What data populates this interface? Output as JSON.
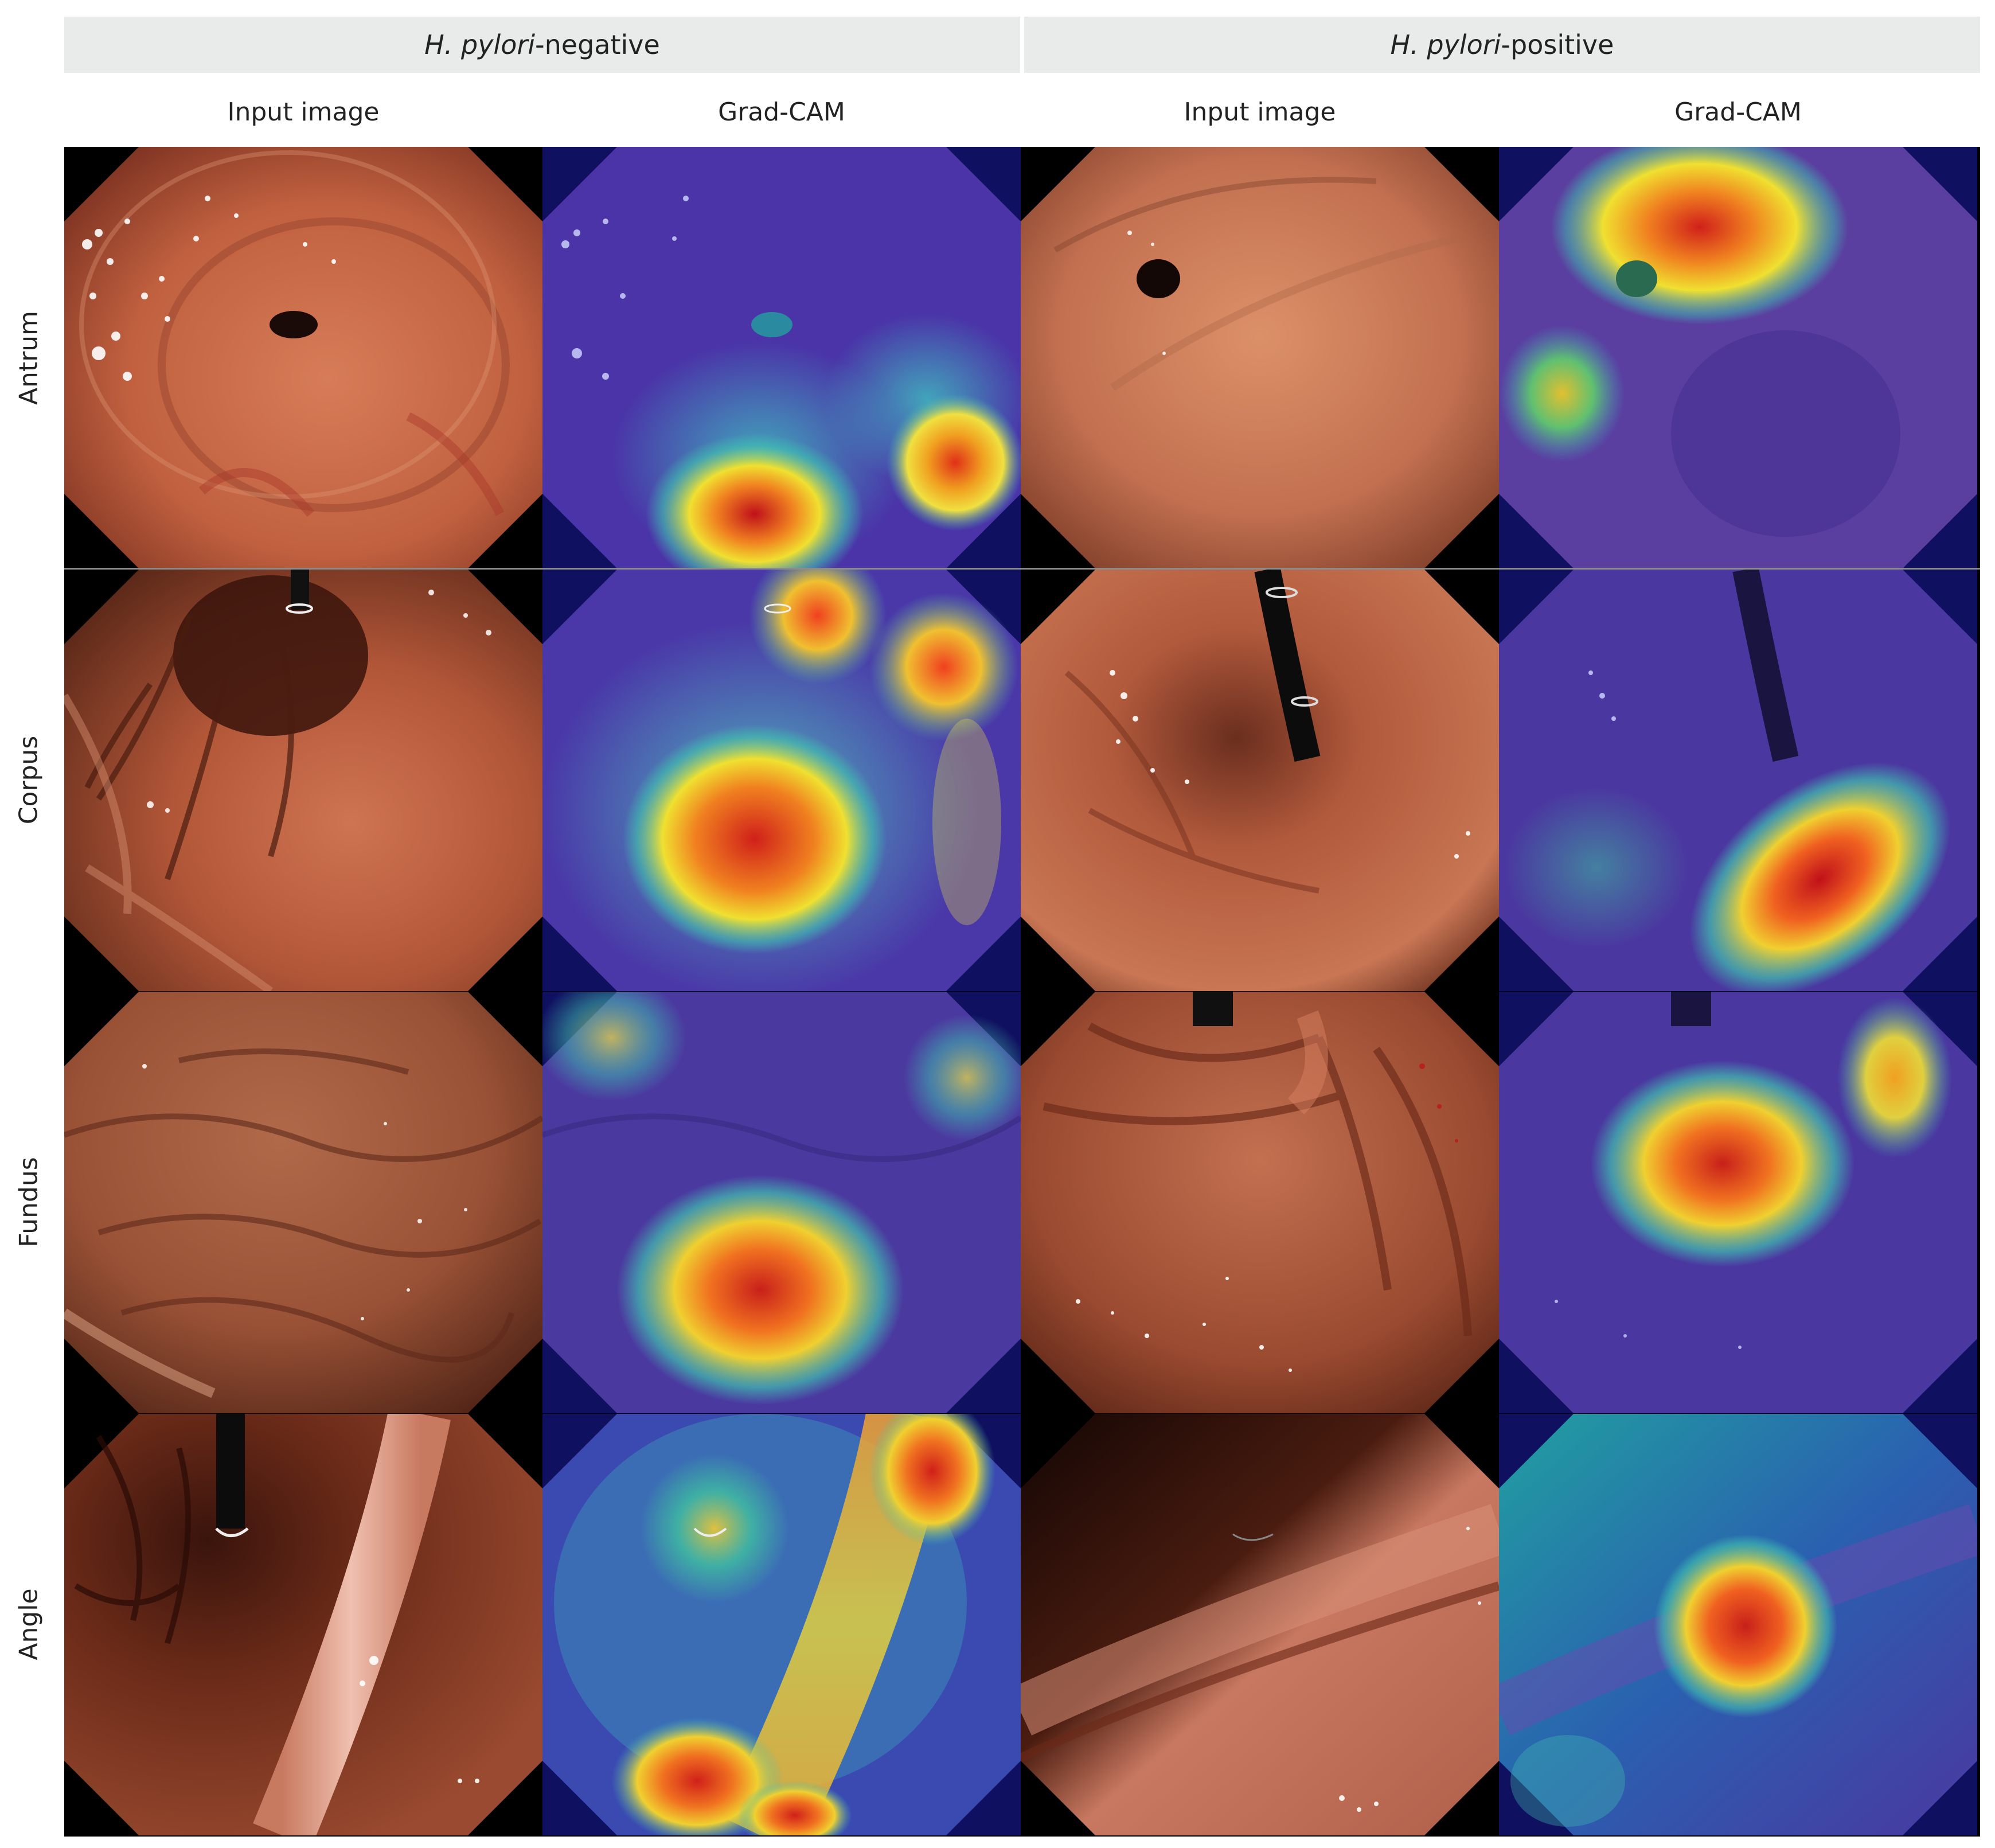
{
  "headers": {
    "negative": {
      "italic": "H. pylori",
      "rest": "-negative"
    },
    "positive": {
      "italic": "H. pylori",
      "rest": "-positive"
    }
  },
  "columns": [
    "Input image",
    "Grad-CAM",
    "Input image",
    "Grad-CAM"
  ],
  "rows": [
    "Antrum",
    "Corpus",
    "Fundus",
    "Angle"
  ],
  "colors": {
    "mucosa_light": "#d8825e",
    "mucosa_mid": "#b8583a",
    "mucosa_dark": "#5a2416",
    "cam_base": "#3a2a9a",
    "cam_hot": "#d8231a",
    "cam_warm": "#f0d020",
    "cam_cool": "#30b0c0",
    "background": "#000000",
    "header_bg": "#e9eaea"
  }
}
